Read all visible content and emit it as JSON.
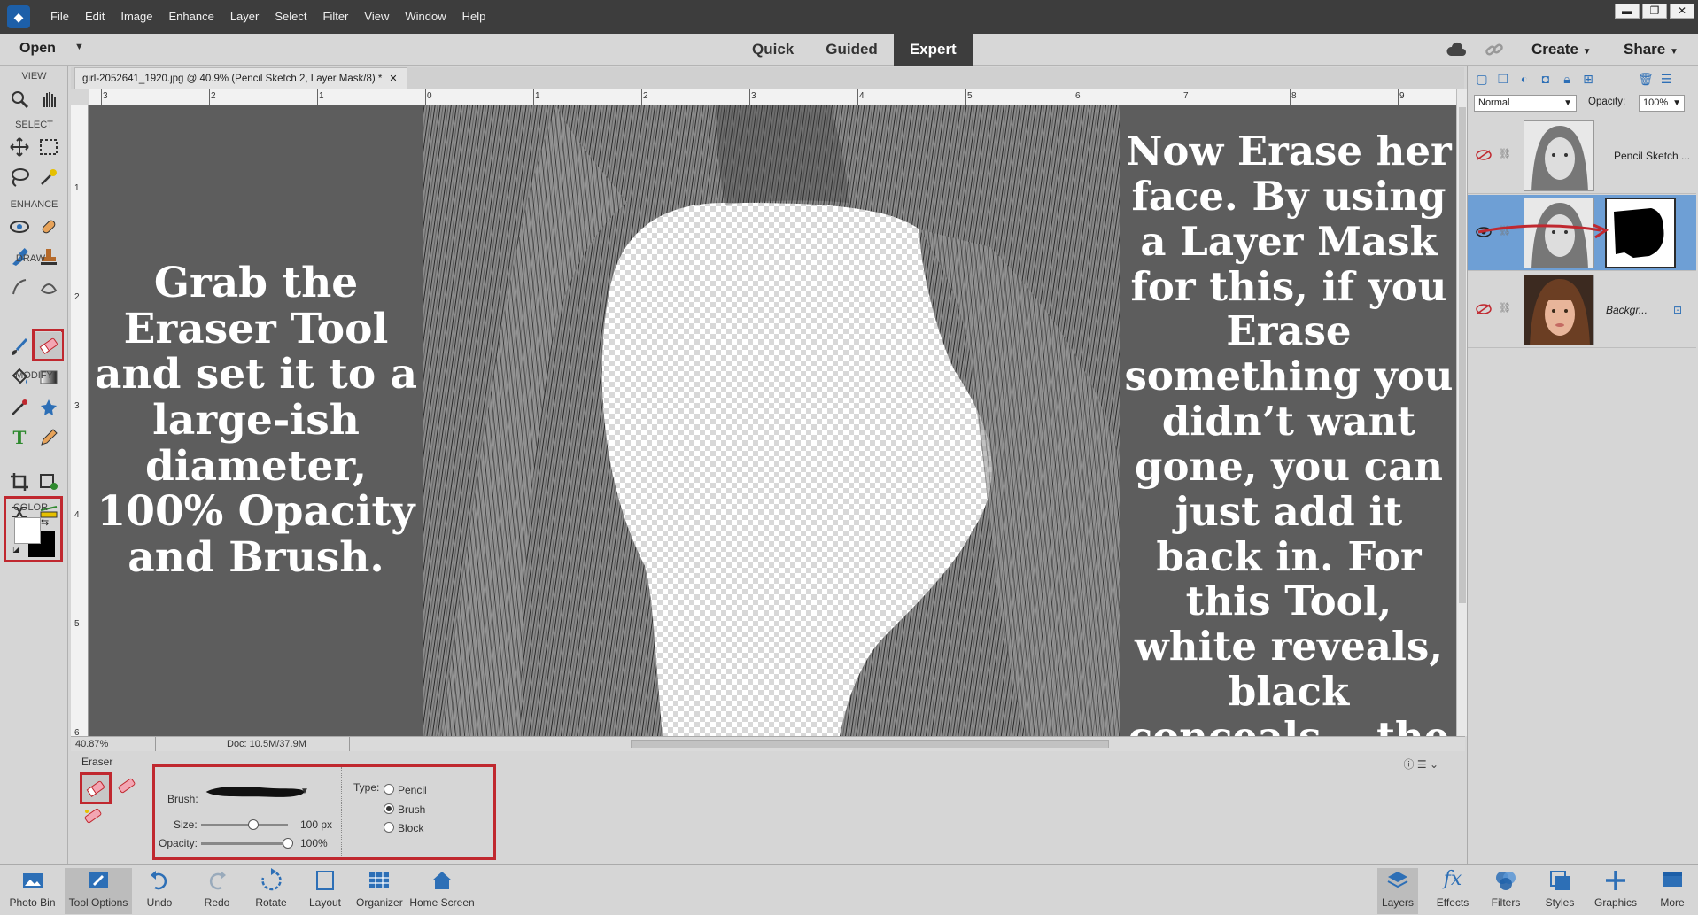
{
  "menubar": {
    "items": [
      "File",
      "Edit",
      "Image",
      "Enhance",
      "Layer",
      "Select",
      "Filter",
      "View",
      "Window",
      "Help"
    ]
  },
  "modebar": {
    "open_label": "Open",
    "tabs": [
      {
        "label": "Quick",
        "active": false
      },
      {
        "label": "Guided",
        "active": false
      },
      {
        "label": "Expert",
        "active": true
      }
    ],
    "create_label": "Create",
    "share_label": "Share"
  },
  "toolbox": {
    "sections": [
      "VIEW",
      "SELECT",
      "ENHANCE",
      "DRAW",
      "MODIFY",
      "COLOR"
    ]
  },
  "document": {
    "tab_title": "girl-2052641_1920.jpg @ 40.9% (Pencil Sketch 2, Layer Mask/8) *",
    "ruler_h": [
      "3",
      "2",
      "1",
      "0",
      "1",
      "2",
      "3",
      "4",
      "5",
      "6",
      "7",
      "8",
      "9"
    ],
    "ruler_v": [
      "1",
      "2",
      "3",
      "4",
      "5",
      "6"
    ]
  },
  "canvas": {
    "left_text": "Grab the Eraser Tool and set it to a large-ish diameter, 100% Opacity and Brush.",
    "right_text": "Now Erase her face. By using a Layer Mask for this, if you Erase something you didn’t want gone, you can just add it back in. For this Tool, white reveals, black conceals... the background."
  },
  "status": {
    "zoom": "40.87%",
    "doc": "Doc: 10.5M/37.9M"
  },
  "tool_options": {
    "title": "Eraser",
    "brush_label": "Brush:",
    "size_label": "Size:",
    "size_value": "100 px",
    "size_fraction": 0.6,
    "opacity_label": "Opacity:",
    "opacity_value": "100%",
    "opacity_fraction": 1.0,
    "type_label": "Type:",
    "types": [
      {
        "label": "Pencil",
        "checked": false
      },
      {
        "label": "Brush",
        "checked": true
      },
      {
        "label": "Block",
        "checked": false
      }
    ]
  },
  "layers": {
    "blend_mode": "Normal",
    "opacity_label": "Opacity:",
    "opacity_value": "100%",
    "items": [
      {
        "name": "Pencil Sketch ...",
        "visible": false,
        "selected": false
      },
      {
        "name": "",
        "visible": true,
        "selected": true
      },
      {
        "name": "Backgr...",
        "visible": false,
        "selected": false
      }
    ]
  },
  "taskbar": {
    "left": [
      "Photo Bin",
      "Tool Options",
      "Undo",
      "Redo",
      "Rotate",
      "Layout",
      "Organizer",
      "Home Screen"
    ],
    "right": [
      "Layers",
      "Effects",
      "Filters",
      "Styles",
      "Graphics",
      "More"
    ]
  },
  "colors": {
    "accent_blue": "#2d6fb6",
    "highlight_red": "#c0282f",
    "selected_layer": "#6e9fd5",
    "canvas_gray": "#5d5d5d"
  }
}
